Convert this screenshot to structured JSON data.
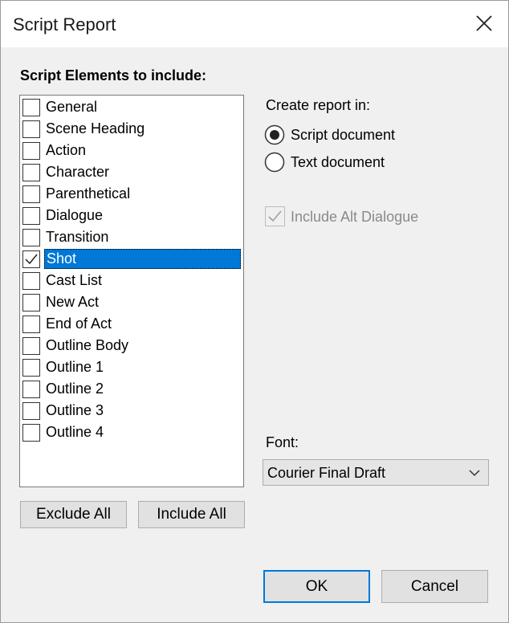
{
  "window": {
    "title": "Script Report"
  },
  "elements": {
    "label": "Script Elements to include:",
    "items": [
      {
        "label": "General",
        "checked": false,
        "selected": false
      },
      {
        "label": "Scene Heading",
        "checked": false,
        "selected": false
      },
      {
        "label": "Action",
        "checked": false,
        "selected": false
      },
      {
        "label": "Character",
        "checked": false,
        "selected": false
      },
      {
        "label": "Parenthetical",
        "checked": false,
        "selected": false
      },
      {
        "label": "Dialogue",
        "checked": false,
        "selected": false
      },
      {
        "label": "Transition",
        "checked": false,
        "selected": false
      },
      {
        "label": "Shot",
        "checked": true,
        "selected": true
      },
      {
        "label": "Cast List",
        "checked": false,
        "selected": false
      },
      {
        "label": "New Act",
        "checked": false,
        "selected": false
      },
      {
        "label": "End of Act",
        "checked": false,
        "selected": false
      },
      {
        "label": "Outline Body",
        "checked": false,
        "selected": false
      },
      {
        "label": "Outline 1",
        "checked": false,
        "selected": false
      },
      {
        "label": "Outline 2",
        "checked": false,
        "selected": false
      },
      {
        "label": "Outline 3",
        "checked": false,
        "selected": false
      },
      {
        "label": "Outline 4",
        "checked": false,
        "selected": false
      }
    ],
    "exclude_all": "Exclude All",
    "include_all": "Include All"
  },
  "create_report": {
    "label": "Create report in:",
    "options": [
      {
        "label": "Script document",
        "selected": true
      },
      {
        "label": "Text document",
        "selected": false
      }
    ]
  },
  "alt_dialogue": {
    "label": "Include Alt Dialogue",
    "checked": true,
    "enabled": false
  },
  "font": {
    "label": "Font:",
    "value": "Courier Final Draft"
  },
  "buttons": {
    "ok": "OK",
    "cancel": "Cancel"
  },
  "colors": {
    "selection": "#0078d7",
    "default_border": "#0078d7"
  },
  "icons": {
    "close": "close-icon",
    "check": "check-icon",
    "dropdown": "chevron-down-icon"
  }
}
